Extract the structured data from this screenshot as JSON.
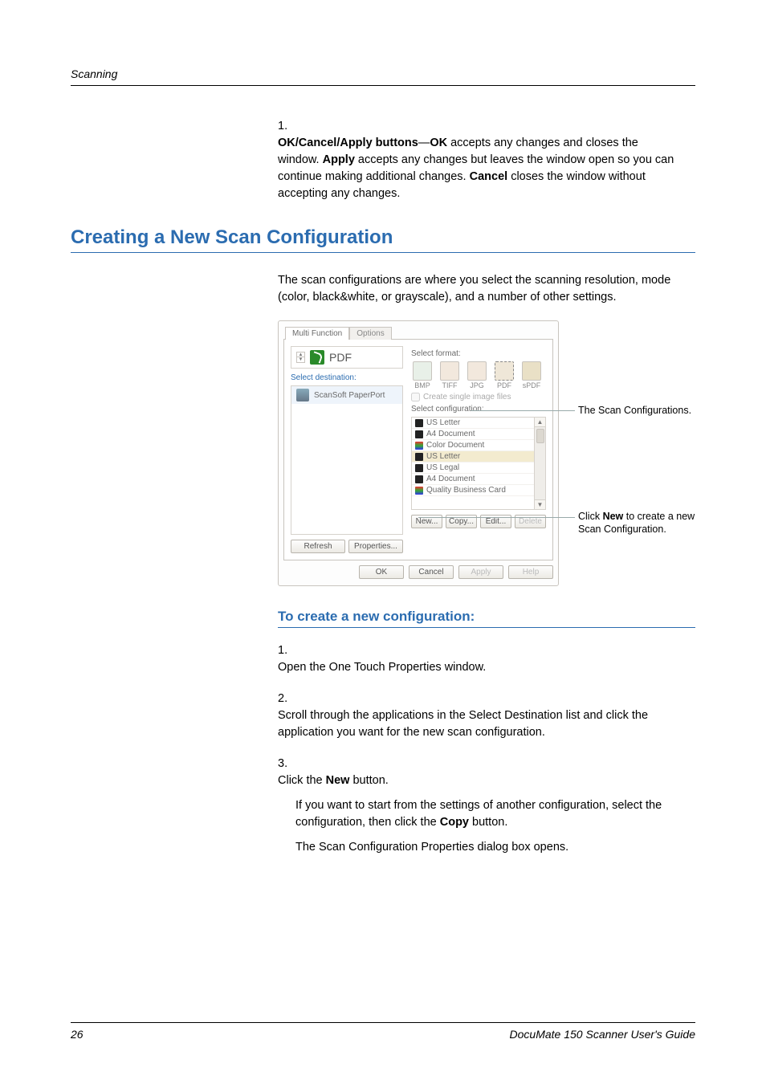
{
  "header": {
    "section": "Scanning"
  },
  "item1": {
    "num": "1.",
    "label": "OK/Cancel/Apply buttons",
    "sep": "—",
    "ok": "OK",
    "t1": " accepts any changes and closes the window. ",
    "apply": "Apply",
    "t2": " accepts any changes but leaves the window open so you can continue making additional changes. ",
    "cancel": "Cancel",
    "t3": " closes the window without accepting any changes."
  },
  "h1": "Creating a New Scan Configuration",
  "intro": "The scan configurations are where you select the scanning resolution, mode (color, black&white, or grayscale), and a number of other settings.",
  "dialog": {
    "tabs": {
      "active": "Multi Function",
      "inactive": "Options"
    },
    "pdf_label": "PDF",
    "select_dest_label": "Select destination:",
    "dest_item": "ScanSoft PaperPort",
    "select_format_label": "Select format:",
    "formats": {
      "bmp": "BMP",
      "tiff": "TIFF",
      "jpg": "JPG",
      "pdf": "PDF",
      "spdf": "sPDF"
    },
    "create_single": "Create single image files",
    "select_config_label": "Select configuration:",
    "configs": [
      "US Letter",
      "A4 Document",
      "Color Document",
      "US Letter",
      "US Legal",
      "A4 Document",
      "Quality Business Card"
    ],
    "btns": {
      "new": "New...",
      "copy": "Copy...",
      "edit": "Edit...",
      "delete": "Delete"
    },
    "left_btns": {
      "refresh": "Refresh",
      "properties": "Properties..."
    },
    "dlg_btns": {
      "ok": "OK",
      "cancel": "Cancel",
      "apply": "Apply",
      "help": "Help"
    }
  },
  "callouts": {
    "c1": "The Scan Configurations.",
    "c2a": "Click ",
    "c2b": "New",
    "c2c": " to create a new Scan Configuration."
  },
  "h2": "To create a new configuration:",
  "steps": {
    "s1": {
      "num": "1.",
      "text": "Open the One Touch Properties window."
    },
    "s2": {
      "num": "2.",
      "text": "Scroll through the applications in the Select Destination list and click the application you want for the new scan configuration."
    },
    "s3": {
      "num": "3.",
      "a": "Click the ",
      "b": "New",
      "c": " button.",
      "p2a": "If you want to start from the settings of another configuration, select the configuration, then click the ",
      "p2b": "Copy",
      "p2c": " button.",
      "p3": "The Scan Configuration Properties dialog box opens."
    }
  },
  "footer": {
    "page": "26",
    "title": "DocuMate 150 Scanner User's Guide"
  }
}
